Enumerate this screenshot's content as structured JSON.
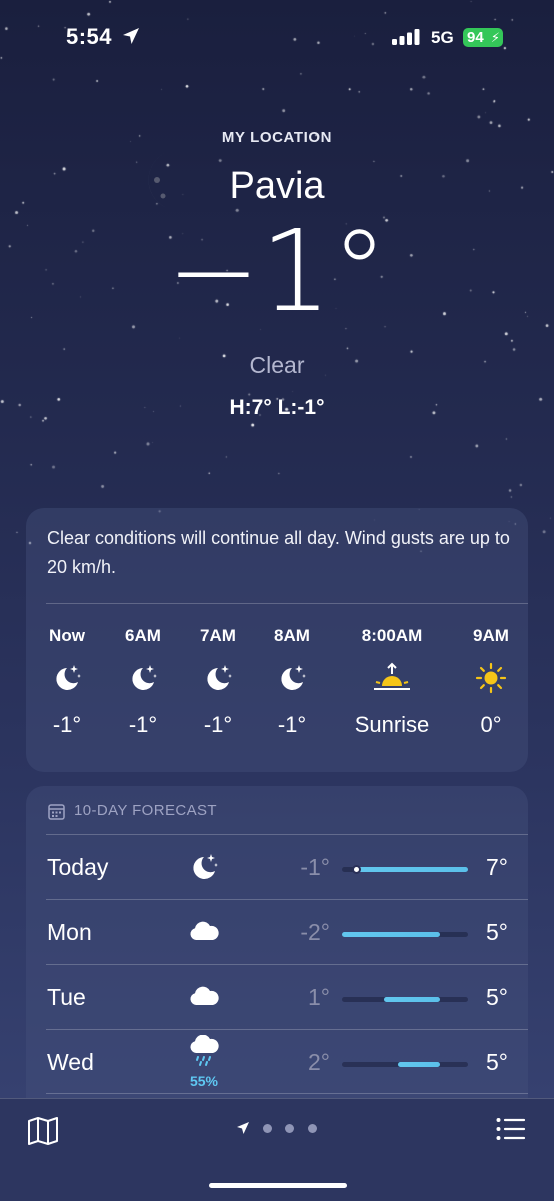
{
  "status_bar": {
    "time": "5:54",
    "network": "5G",
    "battery": "94"
  },
  "header": {
    "location_label": "MY LOCATION",
    "city": "Pavia",
    "temperature": "−1°",
    "condition": "Clear",
    "high_low": "H:7°  L:-1°"
  },
  "hourly": {
    "summary": "Clear conditions will continue all day. Wind gusts are up to 20 km/h.",
    "items": [
      {
        "time": "Now",
        "icon": "moon-stars-icon",
        "temp": "-1°"
      },
      {
        "time": "6AM",
        "icon": "moon-stars-icon",
        "temp": "-1°"
      },
      {
        "time": "7AM",
        "icon": "moon-stars-icon",
        "temp": "-1°"
      },
      {
        "time": "8AM",
        "icon": "moon-stars-icon",
        "temp": "-1°"
      },
      {
        "time": "8:00AM",
        "icon": "sunrise-icon",
        "temp": "Sunrise"
      },
      {
        "time": "9AM",
        "icon": "sun-icon",
        "temp": "0°"
      }
    ]
  },
  "forecast": {
    "title": "10-DAY FORECAST",
    "range_min": -2,
    "range_max": 7,
    "days": [
      {
        "day": "Today",
        "icon": "moon-stars-icon",
        "precip": "",
        "low": "-1°",
        "high": "7°",
        "low_val": -1,
        "high_val": 7,
        "current_val": -1
      },
      {
        "day": "Mon",
        "icon": "cloud-icon",
        "precip": "",
        "low": "-2°",
        "high": "5°",
        "low_val": -2,
        "high_val": 5
      },
      {
        "day": "Tue",
        "icon": "cloud-icon",
        "precip": "",
        "low": "1°",
        "high": "5°",
        "low_val": 1,
        "high_val": 5
      },
      {
        "day": "Wed",
        "icon": "cloud-rain-icon",
        "precip": "55%",
        "low": "2°",
        "high": "5°",
        "low_val": 2,
        "high_val": 5
      }
    ]
  },
  "colors": {
    "battery": "#34c759",
    "temp_bar": "#5bc0ea",
    "sun": "#f5c518",
    "precip": "#5fc8f2"
  }
}
